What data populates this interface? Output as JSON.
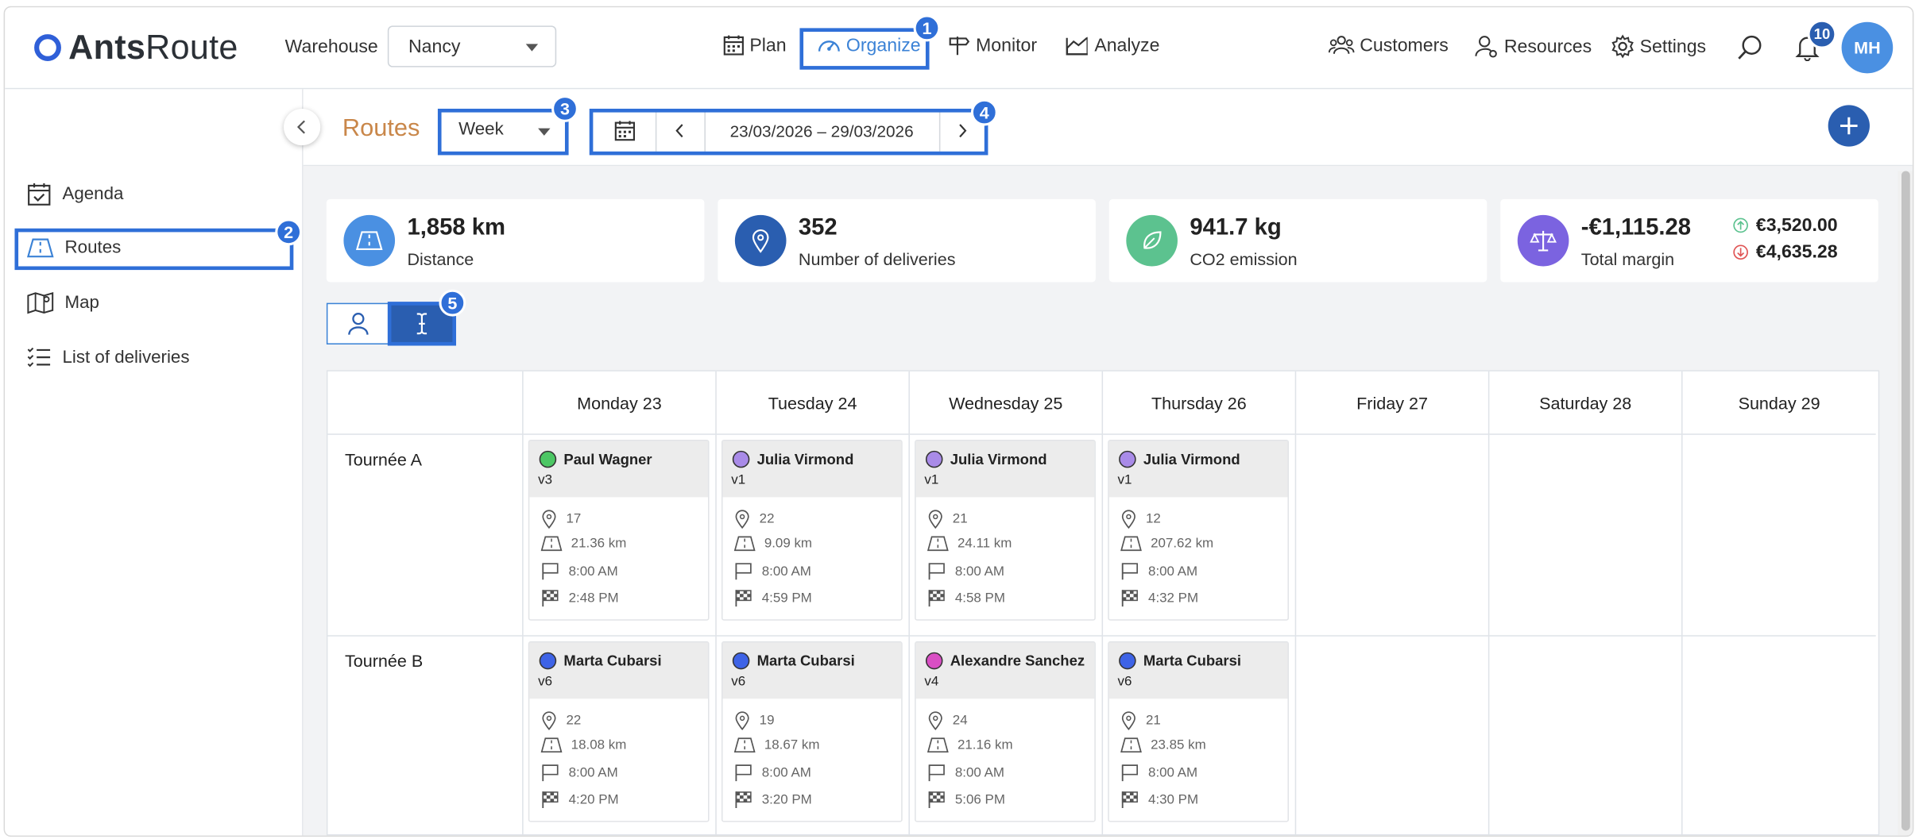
{
  "header": {
    "logo_bold": "Ants",
    "logo_light": "Route",
    "warehouse_label": "Warehouse",
    "warehouse_value": "Nancy",
    "nav": {
      "plan": "Plan",
      "organize": "Organize",
      "monitor": "Monitor",
      "analyze": "Analyze"
    },
    "customers": "Customers",
    "resources": "Resources",
    "settings": "Settings",
    "notifications_count": "10",
    "avatar_initials": "MH"
  },
  "annotations": {
    "b1": "1",
    "b2": "2",
    "b3": "3",
    "b4": "4",
    "b5": "5"
  },
  "sidebar": {
    "items": [
      {
        "label": "Agenda",
        "icon": "calendar-check-icon"
      },
      {
        "label": "Routes",
        "icon": "road-icon"
      },
      {
        "label": "Map",
        "icon": "map-icon"
      },
      {
        "label": "List of deliveries",
        "icon": "list-icon"
      }
    ]
  },
  "toolbar": {
    "title": "Routes",
    "period": "Week",
    "date_range": "23/03/2026 – 29/03/2026"
  },
  "stats": {
    "distance": {
      "value": "1,858 km",
      "label": "Distance"
    },
    "deliveries": {
      "value": "352",
      "label": "Number of deliveries"
    },
    "co2": {
      "value": "941.7 kg",
      "label": "CO2 emission"
    },
    "margin": {
      "value": "-€1,115.28",
      "label": "Total margin",
      "up": "€3,520.00",
      "down": "€4,635.28"
    }
  },
  "colors": {
    "accent": "#3b82d6",
    "highlight": "#2f6fd8",
    "title": "#c9874a",
    "stat_blue": "#4a90e2",
    "stat_dark": "#2a5eb0",
    "stat_green": "#5cc28f",
    "stat_purple": "#7b63e0"
  },
  "days": [
    "Monday 23",
    "Tuesday 24",
    "Wednesday 25",
    "Thursday 26",
    "Friday 27",
    "Saturday 28",
    "Sunday 29"
  ],
  "rows": [
    {
      "name": "Tournée A",
      "routes": [
        {
          "driver": "Paul Wagner",
          "dot": "#4cc764",
          "version": "v3",
          "stops": "17",
          "distance": "21.36 km",
          "start": "8:00 AM",
          "end": "2:48 PM"
        },
        {
          "driver": "Julia Virmond",
          "dot": "#a98be8",
          "version": "v1",
          "stops": "22",
          "distance": "9.09 km",
          "start": "8:00 AM",
          "end": "4:59 PM"
        },
        {
          "driver": "Julia Virmond",
          "dot": "#a98be8",
          "version": "v1",
          "stops": "21",
          "distance": "24.11 km",
          "start": "8:00 AM",
          "end": "4:58 PM"
        },
        {
          "driver": "Julia Virmond",
          "dot": "#a98be8",
          "version": "v1",
          "stops": "12",
          "distance": "207.62 km",
          "start": "8:00 AM",
          "end": "4:32 PM"
        }
      ]
    },
    {
      "name": "Tournée B",
      "routes": [
        {
          "driver": "Marta Cubarsi",
          "dot": "#3e63e6",
          "version": "v6",
          "stops": "22",
          "distance": "18.08 km",
          "start": "8:00 AM",
          "end": "4:20 PM"
        },
        {
          "driver": "Marta Cubarsi",
          "dot": "#3e63e6",
          "version": "v6",
          "stops": "19",
          "distance": "18.67 km",
          "start": "8:00 AM",
          "end": "3:20 PM"
        },
        {
          "driver": "Alexandre Sanchez",
          "dot": "#d94fc4",
          "version": "v4",
          "stops": "24",
          "distance": "21.16 km",
          "start": "8:00 AM",
          "end": "5:06 PM"
        },
        {
          "driver": "Marta Cubarsi",
          "dot": "#3e63e6",
          "version": "v6",
          "stops": "21",
          "distance": "23.85 km",
          "start": "8:00 AM",
          "end": "4:30 PM"
        }
      ]
    }
  ]
}
